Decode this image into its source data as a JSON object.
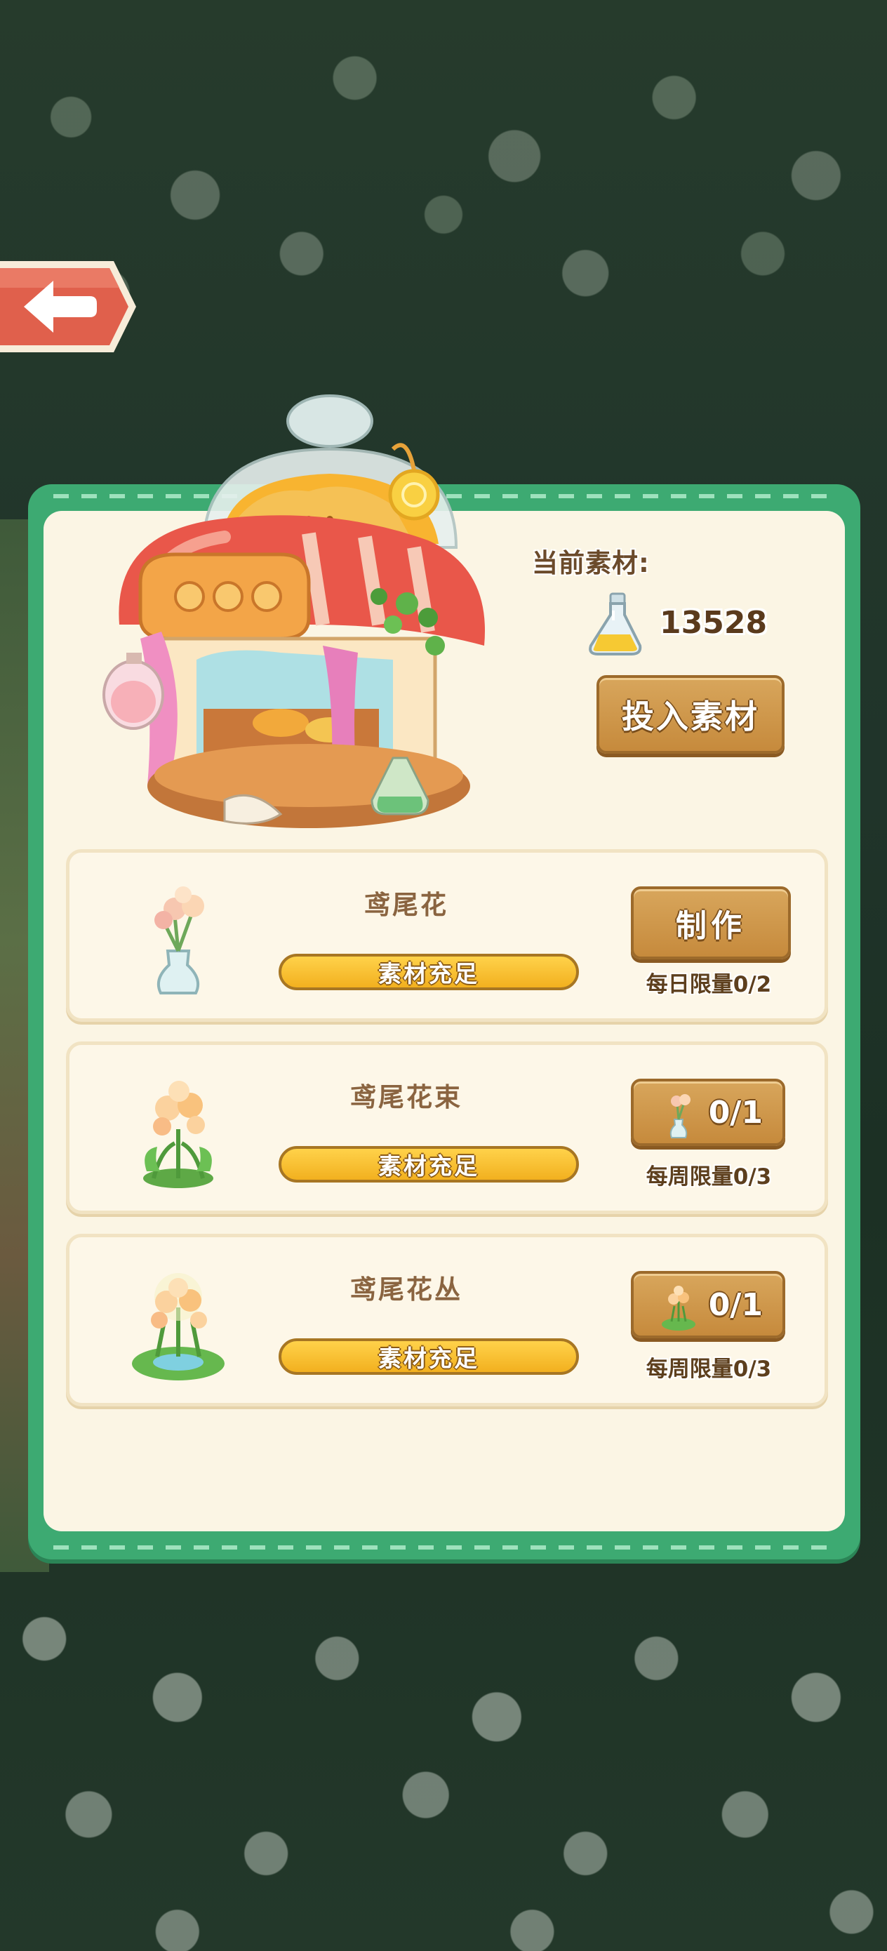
{
  "header": {
    "back_icon": "arrow-left-icon",
    "building_image": "mushroom-workshop-illustration"
  },
  "material": {
    "label": "当前素材:",
    "icon": "flask-icon",
    "count": "13528",
    "invest_button_label": "投入素材"
  },
  "recipes": [
    {
      "name": "鸢尾花",
      "icon": "iris-vase-icon",
      "status": "素材充足",
      "button_label": "制作",
      "limit": "每日限量0/2"
    },
    {
      "name": "鸢尾花束",
      "icon": "iris-bouquet-icon",
      "status": "素材充足",
      "button_label": "0/1",
      "limit": "每周限量0/3"
    },
    {
      "name": "鸢尾花丛",
      "icon": "iris-bush-icon",
      "status": "素材充足",
      "button_label": "0/1",
      "limit": "每周限量0/3"
    }
  ],
  "colors": {
    "panel_green": "#3daa72",
    "panel_inner": "#fbf5e4",
    "button_brown": "#c68a3c",
    "status_bar_yellow": "#f2b01f",
    "back_button_red": "#e0604c"
  }
}
